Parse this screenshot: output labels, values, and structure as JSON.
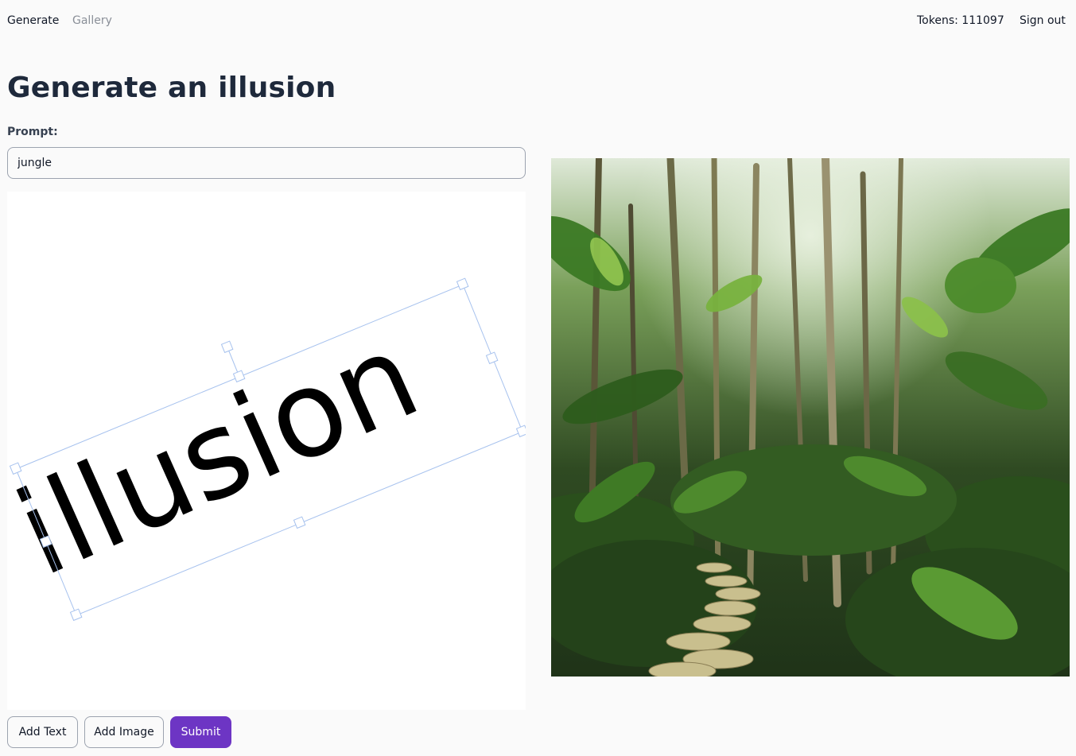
{
  "nav": {
    "generate": "Generate",
    "gallery": "Gallery",
    "tokens": "Tokens: 111097",
    "sign_out": "Sign out"
  },
  "page": {
    "title": "Generate an illusion",
    "prompt_label": "Prompt:",
    "prompt_value": "jungle"
  },
  "canvas": {
    "text_object": "illusion",
    "selection_color": "#a7c2ee"
  },
  "buttons": {
    "add_text": "Add Text",
    "add_image": "Add Image",
    "submit": "Submit"
  },
  "colors": {
    "accent": "#6d35c4",
    "title": "#1e293b",
    "nav_muted": "#8a8f98"
  }
}
